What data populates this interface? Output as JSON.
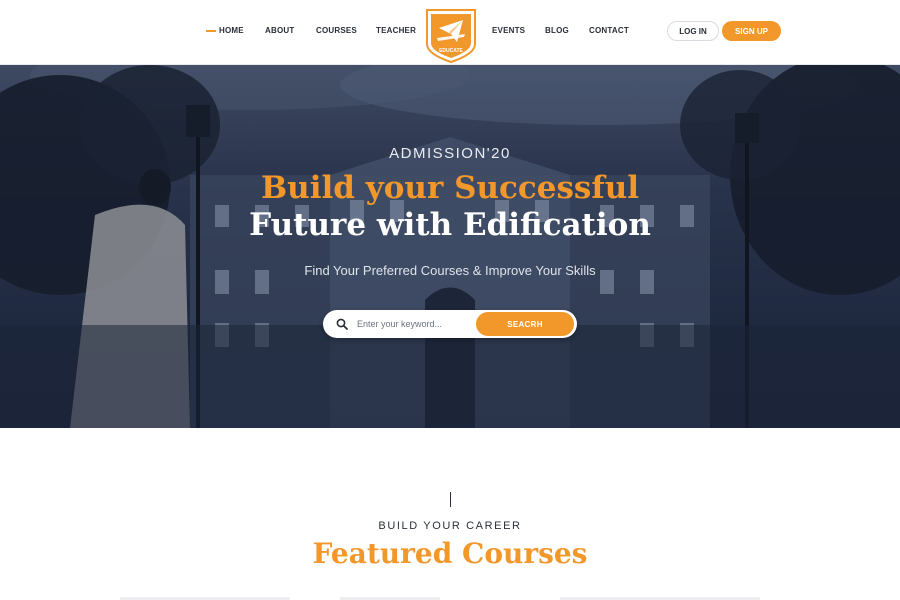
{
  "colors": {
    "accent": "#f2972a",
    "dark": "#2a2f3a",
    "hero_overlay": "#1f2940"
  },
  "nav": {
    "items": [
      {
        "label": "HOME",
        "active": true
      },
      {
        "label": "ABOUT"
      },
      {
        "label": "COURSES"
      },
      {
        "label": "TEACHER"
      },
      {
        "label": "EVENTS"
      },
      {
        "label": "BLOG"
      },
      {
        "label": "CONTACT"
      }
    ],
    "login_label": "LOG IN",
    "signup_label": "SIGN UP",
    "logo_icon": "graduation-cap-shield-logo",
    "logo_text": "EDUCATE"
  },
  "hero": {
    "eyebrow": "ADMISSION'20",
    "title_line1": "Build your Successful",
    "title_line2": "Future with Edification",
    "subtitle": "Find Your Preferred Courses & Improve Your Skills",
    "search_placeholder": "Enter your keyword...",
    "search_button": "SEACRH",
    "search_icon": "search-icon"
  },
  "featured": {
    "eyebrow": "BUILD YOUR CAREER",
    "title": "Featured Courses"
  }
}
